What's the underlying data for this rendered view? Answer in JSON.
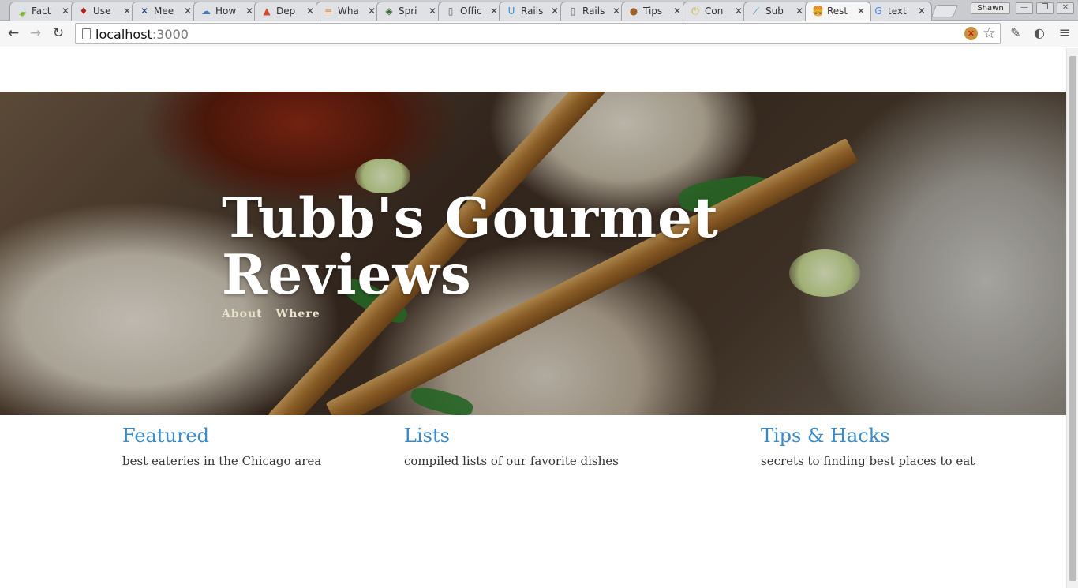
{
  "browser": {
    "tabs": [
      {
        "title": "Fact",
        "icon": "leaf-icon",
        "glyph": "🍃",
        "color": "#4a9b3c"
      },
      {
        "title": "Use",
        "icon": "ruby-icon",
        "glyph": "♦",
        "color": "#b0201c"
      },
      {
        "title": "Mee",
        "icon": "meetup-icon",
        "glyph": "✕",
        "color": "#1c3f7a"
      },
      {
        "title": "How",
        "icon": "cloud-icon",
        "glyph": "☁",
        "color": "#4a78b8"
      },
      {
        "title": "Dep",
        "icon": "heroku-icon",
        "glyph": "▲",
        "color": "#d64a2c"
      },
      {
        "title": "Wha",
        "icon": "stackoverflow-icon",
        "glyph": "≡",
        "color": "#e07b23"
      },
      {
        "title": "Spri",
        "icon": "spring-icon",
        "glyph": "◈",
        "color": "#3e6b33"
      },
      {
        "title": "Offic",
        "icon": "document-icon",
        "glyph": "▯",
        "color": "#666666"
      },
      {
        "title": "Rails",
        "icon": "u-icon",
        "glyph": "U",
        "color": "#3b8fd6"
      },
      {
        "title": "Rails",
        "icon": "document-icon",
        "glyph": "▯",
        "color": "#666666"
      },
      {
        "title": "Tips",
        "icon": "cookie-icon",
        "glyph": "●",
        "color": "#a0602a"
      },
      {
        "title": "Con",
        "icon": "power-icon",
        "glyph": "⏻",
        "color": "#d4b12a"
      },
      {
        "title": "Sub",
        "icon": "sublime-icon",
        "glyph": "⟋",
        "color": "#2b8fc7"
      },
      {
        "title": "Rest",
        "icon": "burger-icon",
        "glyph": "🍔",
        "color": "#c06a1c",
        "active": true
      },
      {
        "title": "text",
        "icon": "google-icon",
        "glyph": "G",
        "color": "#4285f4"
      }
    ],
    "profile_name": "Shawn",
    "url_host": "localhost",
    "url_port": ":3000"
  },
  "hero": {
    "title": "Tubb's Gourmet Reviews",
    "nav": [
      "About",
      "Where"
    ]
  },
  "sections": [
    {
      "title": "Featured",
      "description": "best eateries in the Chicago area"
    },
    {
      "title": "Lists",
      "description": "compiled lists of our favorite dishes"
    },
    {
      "title": "Tips & Hacks",
      "description": "secrets to finding best places to eat"
    }
  ],
  "colors": {
    "link_blue": "#3a8ac7",
    "nav_cream": "#e9e2cc"
  }
}
